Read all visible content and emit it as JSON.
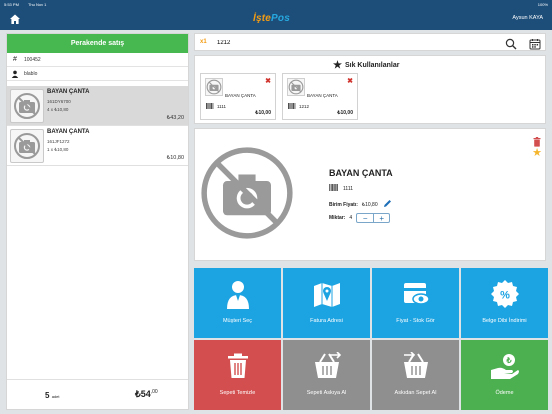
{
  "status_bar": {
    "time": "5:53 PM",
    "date": "Thu Nov 1",
    "battery": "100%"
  },
  "header": {
    "logo_part1": "İşte",
    "logo_part2": "Pos",
    "user_name": "Aysun KAYA"
  },
  "left_panel": {
    "title": "Perakende satış",
    "document_no": "100452",
    "customer": "blablo",
    "items": [
      {
        "name": "BAYAN ÇANTA",
        "code": "161DY6700",
        "qty_line": "4 x ₺10,80",
        "total": "₺43,20"
      },
      {
        "name": "BAYAN ÇANTA",
        "code": "161JF1272",
        "qty_line": "1 x ₺10,80",
        "total": "₺10,80"
      }
    ],
    "footer": {
      "count": "5",
      "count_unit": "adet",
      "total_main": "₺54",
      "total_decimal": ",00"
    }
  },
  "search": {
    "multiplier": "x1",
    "value": "1212"
  },
  "favorites": {
    "title": "Sık Kullanılanlar",
    "items": [
      {
        "name": "BAYAN ÇANTA",
        "barcode": "1111",
        "price": "₺10,00"
      },
      {
        "name": "BAYAN ÇANTA",
        "barcode": "1212",
        "price": "₺10,00"
      }
    ]
  },
  "product_detail": {
    "name": "BAYAN ÇANTA",
    "barcode": "1111",
    "unit_price_label": "Birim Fiyatı:",
    "unit_price": "₺10,80",
    "qty_label": "Miktar:",
    "qty": "4",
    "minus": "−",
    "plus": "+"
  },
  "actions": [
    {
      "label": "Müşteri Seç",
      "color": "#1ca3e2",
      "icon": "user-icon"
    },
    {
      "label": "Fatura Adresi",
      "color": "#1ca3e2",
      "icon": "map-icon"
    },
    {
      "label": "Fiyat - Stok Gör",
      "color": "#1ca3e2",
      "icon": "price-view-icon"
    },
    {
      "label": "Belge Dibi İndirimi",
      "color": "#1ca3e2",
      "icon": "discount-icon"
    },
    {
      "label": "Sepeti Temizle",
      "color": "#d34f4f",
      "icon": "trash-icon"
    },
    {
      "label": "Sepeti Askıya Al",
      "color": "#8f8f8f",
      "icon": "basket-suspend-icon"
    },
    {
      "label": "Askıdan Sepet Al",
      "color": "#8f8f8f",
      "icon": "basket-restore-icon"
    },
    {
      "label": "Ödeme",
      "color": "#4caf50",
      "icon": "payment-icon"
    }
  ]
}
